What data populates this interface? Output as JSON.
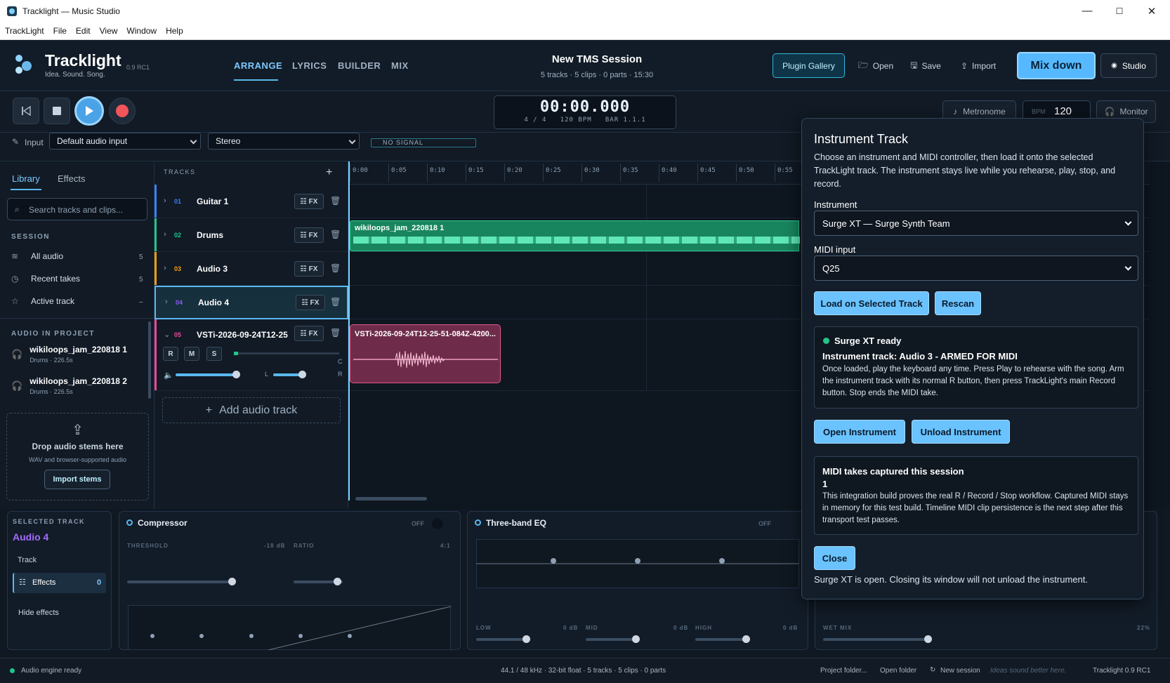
{
  "window": {
    "title": "Tracklight — Music Studio",
    "minimize": "—",
    "maximize": "☐",
    "close": "✕"
  },
  "menu": [
    "TrackLight",
    "File",
    "Edit",
    "View",
    "Window",
    "Help"
  ],
  "header": {
    "brand": "Tracklight",
    "tagline": "Idea. Sound. Song.",
    "version": "0.9 RC1",
    "tabs": [
      "ARRANGE",
      "LYRICS",
      "BUILDER",
      "MIX"
    ],
    "active_tab": "ARRANGE",
    "session_title": "New TMS Session",
    "session_sub": "5 tracks · 5 clips · 0 parts · 15:30",
    "plugin_gallery": "Plugin Gallery",
    "open": "Open",
    "save": "Save",
    "import": "Import",
    "mixdown": "Mix down",
    "studio": "Studio"
  },
  "transport": {
    "time": "00:00.000",
    "meta": "4 / 4   120 BPM   BAR 1.1.1",
    "metronome": "Metronome",
    "bpm_label": "BPM",
    "bpm_value": "120",
    "monitor": "Monitor"
  },
  "input": {
    "label": "Input",
    "device": "Default audio input",
    "channels": "Stereo",
    "signal": "NO SIGNAL"
  },
  "sidebar": {
    "tabs": [
      "Library",
      "Effects"
    ],
    "search_placeholder": "Search tracks and clips...",
    "session_heading": "SESSION",
    "session_items": [
      {
        "label": "All audio",
        "count": "5"
      },
      {
        "label": "Recent takes",
        "count": "5"
      },
      {
        "label": "Active track",
        "count": "–"
      }
    ],
    "audio_heading": "AUDIO IN PROJECT",
    "audio_items": [
      {
        "name": "wikiloops_jam_220818 1",
        "meta": "Drums · 226.5s"
      },
      {
        "name": "wikiloops_jam_220818 2",
        "meta": "Drums · 226.5s"
      }
    ],
    "drop_title": "Drop audio stems here",
    "drop_sub": "WAV and browser-supported audio",
    "import_stems": "Import stems"
  },
  "tracks": {
    "heading": "TRACKS",
    "list": [
      {
        "num": "01",
        "name": "Guitar 1",
        "color": "#3b82f6"
      },
      {
        "num": "02",
        "name": "Drums",
        "color": "#22c58a"
      },
      {
        "num": "03",
        "name": "Audio 3",
        "color": "#f59e0b"
      },
      {
        "num": "04",
        "name": "Audio 4",
        "color": "#8b5cf6"
      },
      {
        "num": "05",
        "name": "VSTi-2026-09-24T12-25",
        "color": "#ec4899"
      }
    ],
    "fx": "FX",
    "r": "R",
    "m": "M",
    "s": "S",
    "pan_l": "L",
    "pan_r": "R",
    "pan_c": "C",
    "add_track": "Add audio track"
  },
  "ruler": [
    "0:00",
    "0:05",
    "0:10",
    "0:15",
    "0:20",
    "0:25",
    "0:30",
    "0:35",
    "0:40",
    "0:45",
    "0:50",
    "0:55"
  ],
  "clips": {
    "drums": "wikiloops_jam_220818 1",
    "vsti": "VSTi-2026-09-24T12-25-51-084Z-4200..."
  },
  "selected": {
    "heading": "SELECTED TRACK",
    "name": "Audio 4",
    "track": "Track",
    "effects": "Effects",
    "effects_count": "0",
    "hide": "Hide effects"
  },
  "compressor": {
    "title": "Compressor",
    "state": "OFF",
    "threshold": "THRESHOLD",
    "threshold_val": "-18 dB",
    "ratio": "RATIO",
    "ratio_val": "4:1"
  },
  "eq": {
    "title": "Three-band EQ",
    "state": "OFF",
    "low": "LOW",
    "low_val": "0 dB",
    "mid": "MID",
    "mid_val": "0 dB",
    "high": "HIGH",
    "high_val": "0 dB"
  },
  "reverb": {
    "wet": "WET MIX",
    "wet_val": "22%"
  },
  "modal": {
    "title": "Instrument Track",
    "desc": "Choose an instrument and MIDI controller, then load it onto the selected TrackLight track. The instrument stays live while you rehearse, play, stop, and record.",
    "instrument_label": "Instrument",
    "instrument_value": "Surge XT — Surge Synth Team",
    "midi_label": "MIDI input",
    "midi_value": "Q25",
    "load": "Load on Selected Track",
    "rescan": "Rescan",
    "ready": "Surge XT ready",
    "armed": "Instrument track: Audio 3 - ARMED FOR MIDI",
    "ready_desc": "Once loaded, play the keyboard any time. Press Play to rehearse with the song. Arm the instrument track with its normal R button, then press TrackLight's main Record button. Stop ends the MIDI take.",
    "open_instrument": "Open Instrument",
    "unload_instrument": "Unload Instrument",
    "takes_title": "MIDI takes captured this session",
    "takes_count": "1",
    "takes_desc": "This integration build proves the real R / Record / Stop workflow. Captured MIDI stays in memory for this test build. Timeline MIDI clip persistence is the next step after this transport test passes.",
    "close": "Close",
    "footer": "Surge XT is open. Closing its window will not unload the instrument."
  },
  "status": {
    "engine": "Audio engine ready",
    "info": "44.1 / 48 kHz · 32-bit float · 5 tracks · 5 clips · 0 parts",
    "project_folder": "Project folder...",
    "open_folder": "Open folder",
    "new_session": "New session",
    "motto": "Ideas sound better here.",
    "version": "Tracklight 0.9 RC1"
  }
}
